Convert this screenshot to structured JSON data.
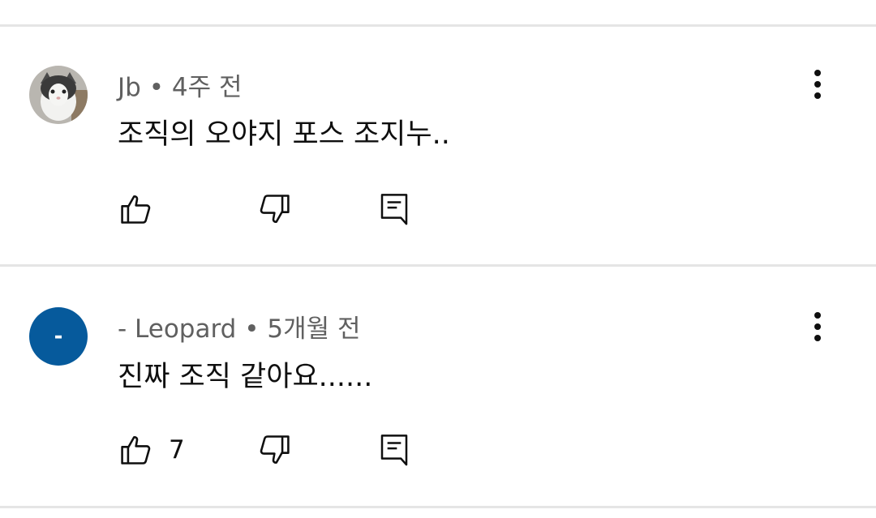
{
  "comments": [
    {
      "author": "Jb",
      "separator": "•",
      "time": "4주 전",
      "text": "조직의 오야지 포스 조지누..",
      "likes": "",
      "avatar": {
        "type": "photo",
        "icon": "cat-photo-avatar"
      }
    },
    {
      "author": "- Leopard",
      "separator": "•",
      "time": "5개월 전",
      "text": "진짜 조직 같아요......",
      "likes": "7",
      "avatar": {
        "type": "letter",
        "letter": "-",
        "color": "#065a9c"
      }
    }
  ],
  "icons": {
    "like": "thumbs-up-icon",
    "dislike": "thumbs-down-icon",
    "reply": "reply-comment-icon",
    "menu": "more-vert-icon"
  }
}
